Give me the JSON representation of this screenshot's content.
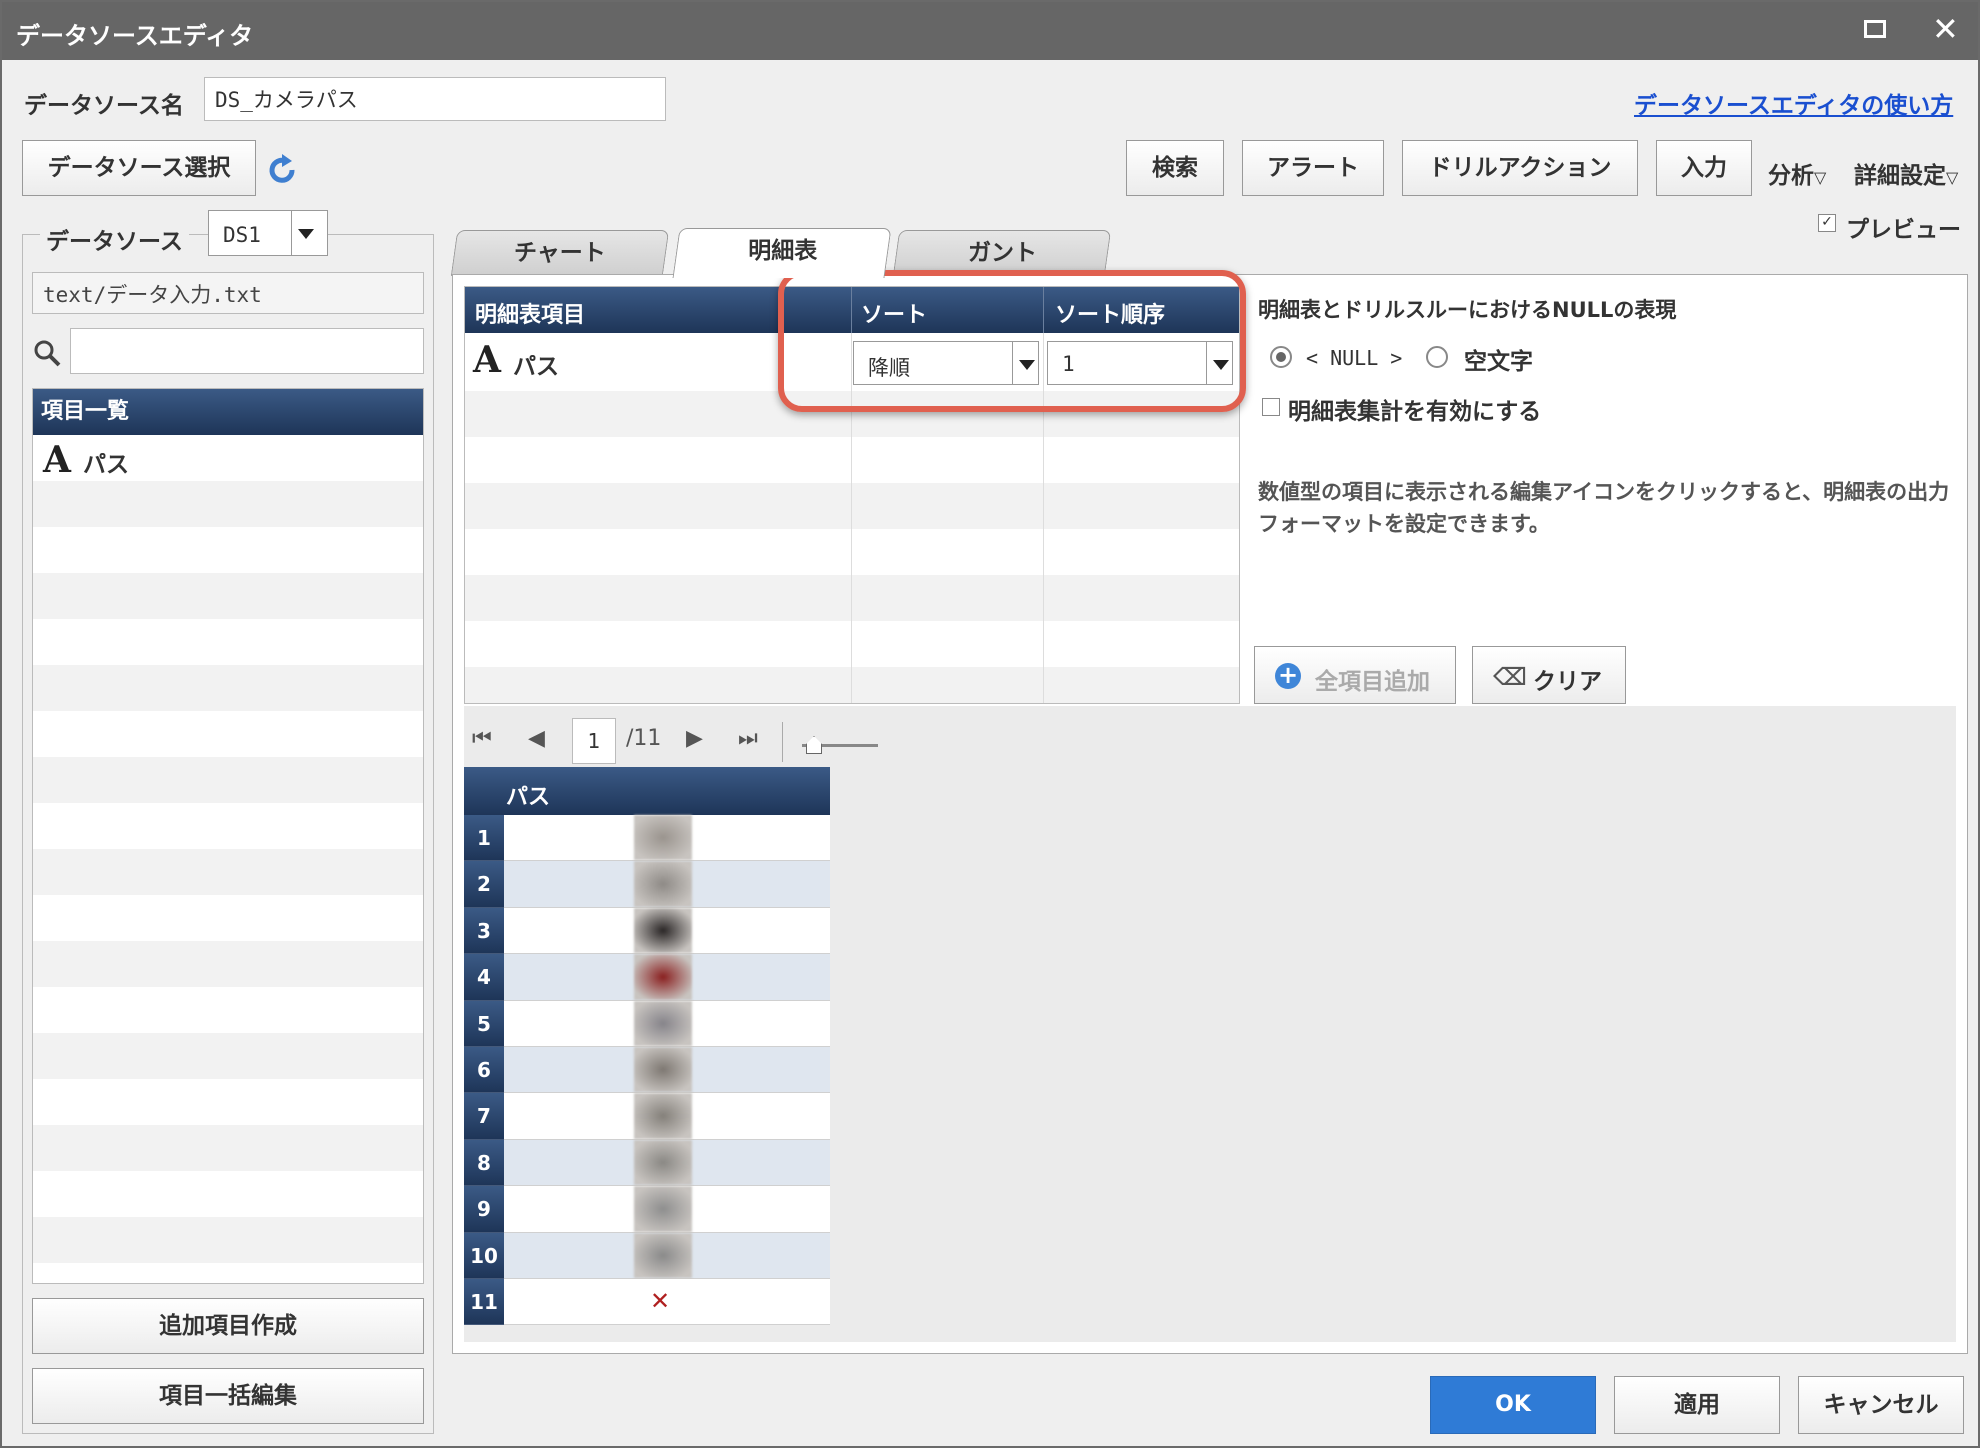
{
  "window": {
    "title": "データソースエディタ",
    "maximize_icon": "maximize-icon",
    "close_symbol": "✕"
  },
  "header": {
    "datasource_name_label": "データソース名",
    "datasource_name_value": "DS_カメラパス",
    "help_link": "データソースエディタの使い方"
  },
  "toolbar": {
    "select_datasource": "データソース選択",
    "search": "検索",
    "alert": "アラート",
    "drill_action": "ドリルアクション",
    "input": "入力",
    "analysis": "分析",
    "detail_settings": "詳細設定",
    "preview": "プレビュー",
    "preview_checked": true
  },
  "sidebar": {
    "group_label": "データソース",
    "datasource_selected": "DS1",
    "file_path": "text/データ入力.txt",
    "search_placeholder": "",
    "list_header": "項目一覧",
    "items": [
      {
        "icon": "text-type-icon",
        "label": "パス"
      }
    ],
    "add_item_button": "追加項目作成",
    "bulk_edit_button": "項目一括編集"
  },
  "tabs": [
    {
      "label": "チャート",
      "active": false
    },
    {
      "label": "明細表",
      "active": true
    },
    {
      "label": "ガント",
      "active": false
    }
  ],
  "detail_table": {
    "columns": [
      "明細表項目",
      "ソート",
      "ソート順序"
    ],
    "rows": [
      {
        "icon": "text-type-icon",
        "item": "パス",
        "sort": "降順",
        "sort_order": "1"
      }
    ]
  },
  "options": {
    "null_label": "明細表とドリルスルーにおけるNULLの表現",
    "null_option": "< NULL >",
    "empty_option": "空文字",
    "null_selected": "null",
    "aggregate_label": "明細表集計を有効にする",
    "aggregate_checked": false,
    "help_text": "数値型の項目に表示される編集アイコンをクリックすると、明細表の出力フォーマットを設定できます。",
    "add_all_button": "全項目追加",
    "clear_button": "クリア"
  },
  "preview": {
    "current_page": "1",
    "total_pages": "/11",
    "column_header": "パス",
    "row_numbers": [
      "1",
      "2",
      "3",
      "4",
      "5",
      "6",
      "7",
      "8",
      "9",
      "10",
      "11"
    ],
    "missing_symbol": "✕"
  },
  "footer": {
    "ok": "OK",
    "apply": "適用",
    "cancel": "キャンセル"
  },
  "colors": {
    "header_blue": "#1e3558",
    "highlight_red": "#e0604f",
    "ok_blue": "#2f7bd6",
    "link_blue": "#1a4fd0"
  }
}
